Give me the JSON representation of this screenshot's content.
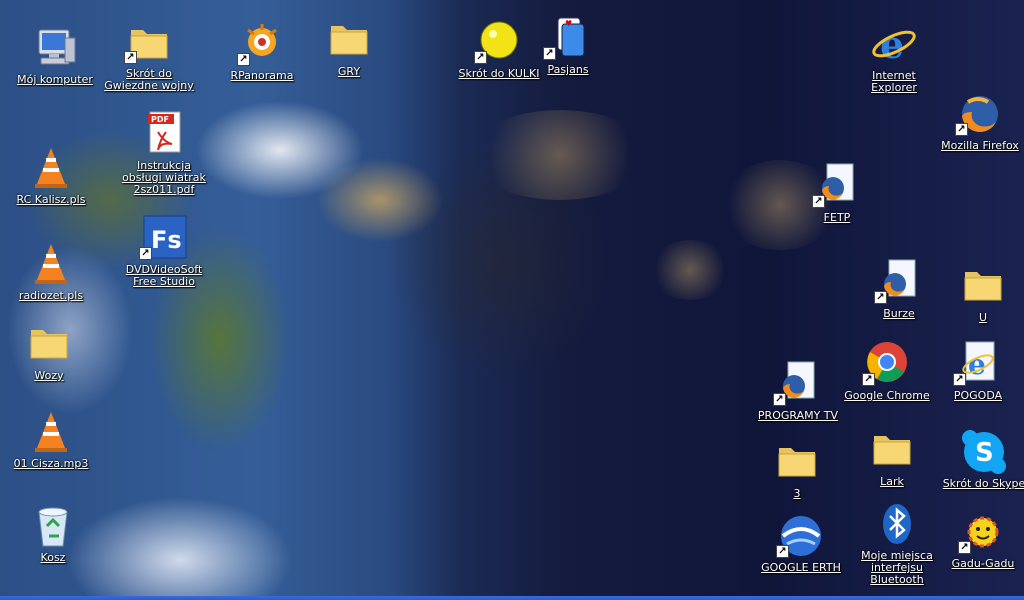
{
  "desktop": {
    "icons": [
      {
        "label": "Mój komputer",
        "icon": "my-computer-icon",
        "shortcut": false
      },
      {
        "label": "Skrót do Gwiezdne wojny",
        "icon": "folder-icon",
        "shortcut": true
      },
      {
        "label": "RPanorama",
        "icon": "panorama-app-icon",
        "shortcut": true
      },
      {
        "label": "GRY",
        "icon": "folder-icon",
        "shortcut": false
      },
      {
        "label": "Skrót do KULKI",
        "icon": "kulki-game-icon",
        "shortcut": true
      },
      {
        "label": "Pasjans",
        "icon": "solitaire-icon",
        "shortcut": true
      },
      {
        "label": "Internet Explorer",
        "icon": "internet-explorer-icon",
        "shortcut": false
      },
      {
        "label": "Instrukcja obsługi wiatrak 2sz011.pdf",
        "icon": "pdf-file-icon",
        "shortcut": false
      },
      {
        "label": "Mozilla Firefox",
        "icon": "firefox-icon",
        "shortcut": true
      },
      {
        "label": "RC Kalisz.pls",
        "icon": "vlc-playlist-icon",
        "shortcut": false
      },
      {
        "label": "FETP",
        "icon": "firefox-url-icon",
        "shortcut": true
      },
      {
        "label": "DVDVideoSoft Free Studio",
        "icon": "dvdvideosoft-icon",
        "shortcut": true
      },
      {
        "label": "radiozet.pls",
        "icon": "vlc-playlist-icon",
        "shortcut": false
      },
      {
        "label": "Burze",
        "icon": "firefox-url-icon",
        "shortcut": true
      },
      {
        "label": "U",
        "icon": "folder-icon",
        "shortcut": false
      },
      {
        "label": "Wozy",
        "icon": "folder-icon",
        "shortcut": false
      },
      {
        "label": "Google Chrome",
        "icon": "chrome-icon",
        "shortcut": true
      },
      {
        "label": "POGODA",
        "icon": "ie-url-icon",
        "shortcut": true
      },
      {
        "label": "PROGRAMY TV",
        "icon": "firefox-url-icon",
        "shortcut": true
      },
      {
        "label": "01 Cisza.mp3",
        "icon": "vlc-audio-icon",
        "shortcut": false
      },
      {
        "label": "3",
        "icon": "folder-icon",
        "shortcut": false
      },
      {
        "label": "Lark",
        "icon": "folder-icon",
        "shortcut": false
      },
      {
        "label": "Skrót do Skype",
        "icon": "skype-icon",
        "shortcut": false
      },
      {
        "label": "Kosz",
        "icon": "recycle-bin-icon",
        "shortcut": false
      },
      {
        "label": "GOOGLE ERTH",
        "icon": "google-earth-icon",
        "shortcut": true
      },
      {
        "label": "Moje miejsca interfejsu Bluetooth",
        "icon": "bluetooth-icon",
        "shortcut": false
      },
      {
        "label": "Gadu-Gadu",
        "icon": "gadu-gadu-icon",
        "shortcut": true
      }
    ]
  },
  "colors": {
    "label_text": "#ffffff",
    "folder_yellow": "#f7d774",
    "vlc_orange": "#f58220",
    "taskbar_blue": "#245edb"
  }
}
